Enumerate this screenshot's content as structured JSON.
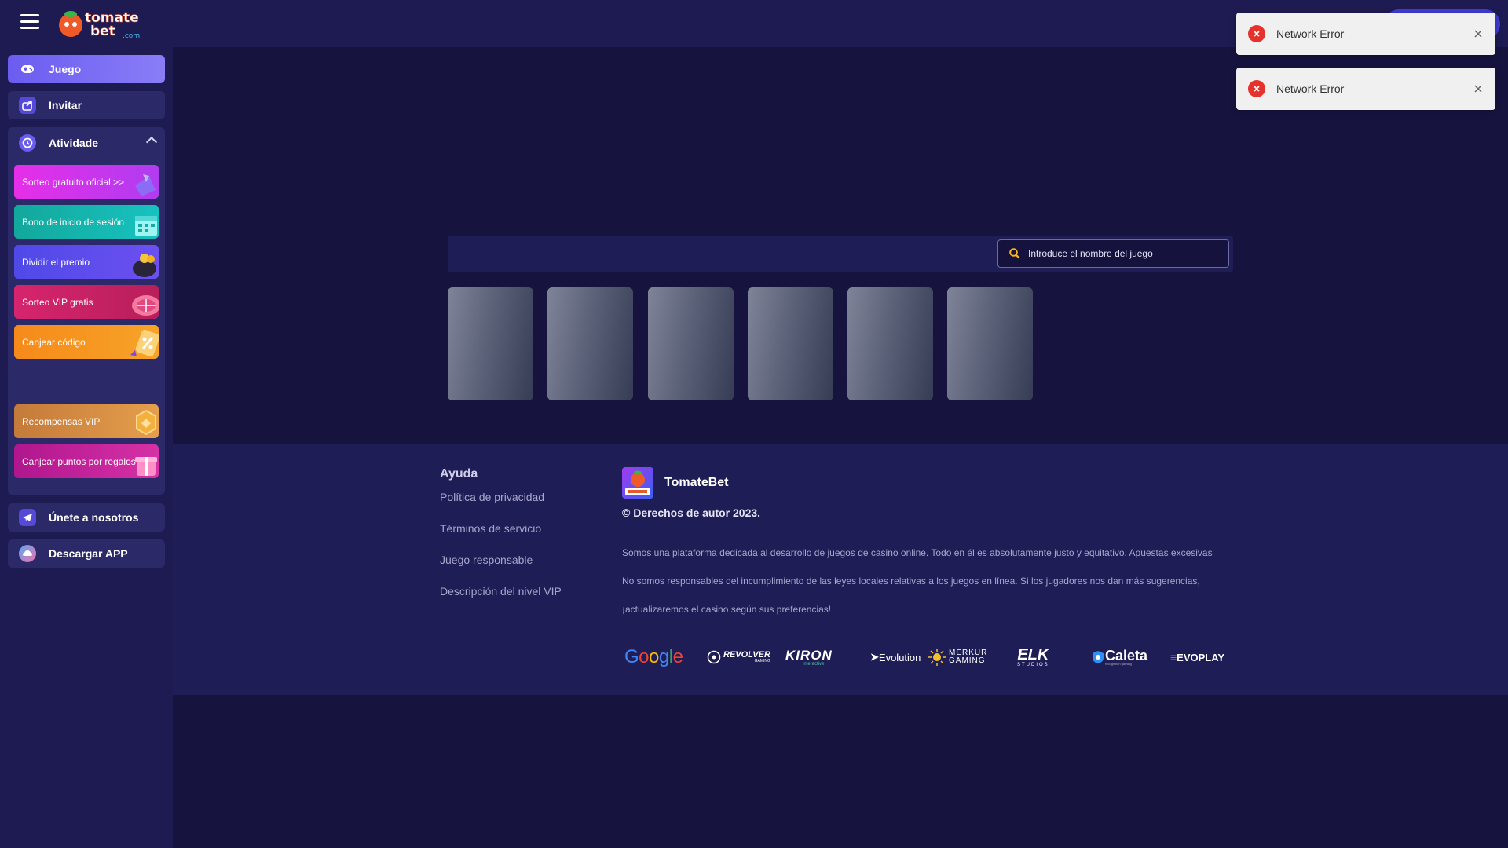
{
  "sidebar": {
    "nav": [
      {
        "label": "Juego",
        "icon": "gamepad-icon"
      },
      {
        "label": "Invitar",
        "icon": "share-icon"
      }
    ],
    "activity": {
      "label": "Atividade",
      "promos": [
        {
          "label": "Sorteo gratuito oficial >>",
          "color_from": "#e62ee8",
          "color_to": "#b03cf0"
        },
        {
          "label": "Bono de inicio de sesión",
          "color_from": "#12a89c",
          "color_to": "#18c2c0"
        },
        {
          "label": "Dividir el premio",
          "color_from": "#4f49e8",
          "color_to": "#6c50f0"
        },
        {
          "label": "Sorteo VIP gratis",
          "color_from": "#d6246e",
          "color_to": "#b81f5a"
        },
        {
          "label": "Canjear código",
          "color_from": "#f58a1a",
          "color_to": "#f7a328"
        },
        {
          "label": "Recompensas VIP",
          "color_from": "#c47a3a",
          "color_to": "#e59e4c"
        },
        {
          "label": "Canjear puntos por regalos",
          "color_from": "#b0168e",
          "color_to": "#d631a6"
        }
      ]
    },
    "bottom_nav": [
      {
        "label": "Únete a nosotros",
        "icon": "telegram-icon"
      },
      {
        "label": "Descargar APP",
        "icon": "download-app-icon"
      }
    ]
  },
  "search": {
    "placeholder": "Introduce el nombre del juego"
  },
  "games": {
    "placeholder_count": 6
  },
  "footer": {
    "help_title": "Ayuda",
    "help_links": [
      "Política de privacidad",
      "Términos de servicio",
      "Juego responsable",
      "Descripción del nivel VIP"
    ],
    "brand_name": "TomateBet",
    "copyright": "© Derechos de autor 2023.",
    "description": [
      "Somos una plataforma dedicada al desarrollo de juegos de casino online. Todo en él es absolutamente justo y equitativo. Apuestas excesivas",
      "No somos responsables del incumplimiento de las leyes locales relativas a los juegos en línea. Si los jugadores nos dan más sugerencias,",
      "¡actualizaremos el casino según sus preferencias!"
    ],
    "partners": [
      "Google",
      "REVOLVER",
      "KIRON",
      "Evolution",
      "MERKUR GAMING",
      "ELK",
      "Caleta",
      "EVOPLAY"
    ],
    "partner_sub": {
      "REVOLVER": "GAMING",
      "KIRON": "interactive",
      "ELK": "STUDIOS",
      "Caleta": "recognition gaming"
    }
  },
  "toasts": [
    {
      "message": "Network Error"
    },
    {
      "message": "Network Error"
    }
  ],
  "logo_text": {
    "line1": "tomate",
    "line2": "bet",
    "suffix": ".com"
  },
  "colors": {
    "page_bg": "#16143f",
    "panel_bg": "#1d1b52",
    "accent": "#6b5cf0",
    "error": "#e5322d"
  }
}
